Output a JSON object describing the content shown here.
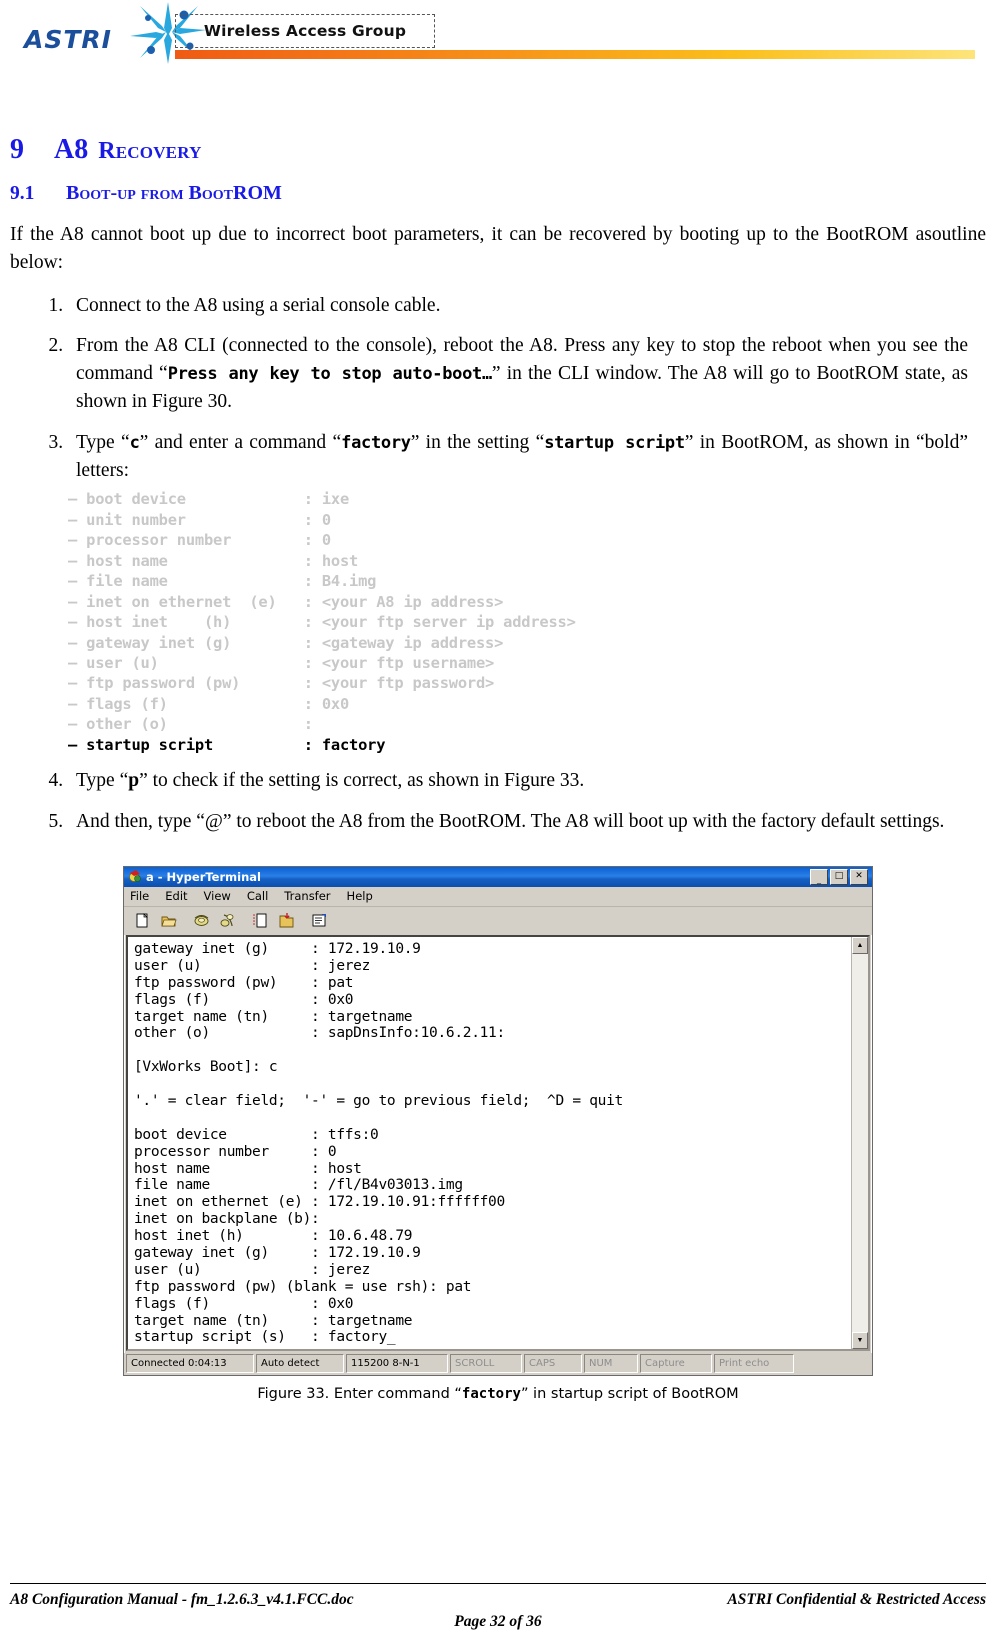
{
  "header": {
    "logo_text": "ASTRI",
    "logo_icon": "starburst-logo-icon",
    "group_label": "Wireless Access Group"
  },
  "section": {
    "h1_number": "9",
    "h1_title_lead": "A8",
    "h1_title_rest": "Recovery",
    "h2_number": "9.1",
    "h2_title": "Boot-up from BootROM",
    "intro": "If the A8 cannot boot up due to incorrect boot parameters, it can be recovered by booting up to the BootROM asoutline below:"
  },
  "steps": [
    {
      "parts": [
        {
          "t": "text",
          "v": "Connect to the A8 using a serial console cable."
        }
      ]
    },
    {
      "parts": [
        {
          "t": "text",
          "v": "From the A8 CLI (connected to the console), reboot the A8. Press any key to stop the reboot when you see the command “"
        },
        {
          "t": "mono",
          "v": "Press any key to stop auto-boot…"
        },
        {
          "t": "text",
          "v": "” in the CLI window. The A8 will go to BootROM state, as shown in Figure 30."
        }
      ]
    },
    {
      "parts": [
        {
          "t": "text",
          "v": "Type “"
        },
        {
          "t": "mono",
          "v": "c"
        },
        {
          "t": "text",
          "v": "” and enter a command “"
        },
        {
          "t": "mono",
          "v": "factory"
        },
        {
          "t": "text",
          "v": "” in the setting “"
        },
        {
          "t": "mono",
          "v": "startup script"
        },
        {
          "t": "text",
          "v": "” in BootROM, as shown in “bold” letters:"
        }
      ]
    },
    {
      "parts": [
        {
          "t": "text",
          "v": "Type “"
        },
        {
          "t": "bold",
          "v": "p"
        },
        {
          "t": "text",
          "v": "” to check if the setting is correct, as shown in Figure 33."
        }
      ]
    },
    {
      "parts": [
        {
          "t": "text",
          "v": "And then, type “@” to reboot the A8 from the BootROM. The A8 will boot up with the factory default settings."
        }
      ]
    }
  ],
  "code_block": [
    {
      "label": "boot device",
      "value": "ixe",
      "bold": false
    },
    {
      "label": "unit number",
      "value": "0",
      "bold": false
    },
    {
      "label": "processor number",
      "value": "0",
      "bold": false
    },
    {
      "label": "host name",
      "value": "host",
      "bold": false
    },
    {
      "label": "file name",
      "value": "B4.img",
      "bold": false
    },
    {
      "label": "inet on ethernet  (e)",
      "value": "<your A8 ip address>",
      "bold": false
    },
    {
      "label": "host inet    (h)",
      "value": "<your ftp server ip address>",
      "bold": false
    },
    {
      "label": "gateway inet (g)",
      "value": "<gateway ip address>",
      "bold": false
    },
    {
      "label": "user (u)",
      "value": "<your ftp username>",
      "bold": false
    },
    {
      "label": "ftp password (pw)",
      "value": "<your ftp password>",
      "bold": false
    },
    {
      "label": "flags (f)",
      "value": "0x0",
      "bold": false
    },
    {
      "label": "other (o)",
      "value": "",
      "bold": false
    },
    {
      "label": "startup script",
      "value": "factory",
      "bold": true
    }
  ],
  "hyperterminal": {
    "title": "a - HyperTerminal",
    "app_icon": "hyperterminal-icon",
    "window_buttons": [
      {
        "name": "minimize-button",
        "glyph": "_"
      },
      {
        "name": "maximize-button",
        "glyph": "□"
      },
      {
        "name": "close-button",
        "glyph": "×"
      }
    ],
    "menus": [
      "File",
      "Edit",
      "View",
      "Call",
      "Transfer",
      "Help"
    ],
    "toolbar": [
      {
        "name": "new-connection-icon"
      },
      {
        "name": "open-folder-icon"
      },
      {
        "name": "disconnect-phone-icon"
      },
      {
        "name": "call-phone-icon"
      },
      {
        "name": "send-file-icon"
      },
      {
        "name": "receive-file-icon"
      },
      {
        "name": "properties-icon"
      }
    ],
    "terminal_lines": [
      "gateway inet (g)     : 172.19.10.9",
      "user (u)             : jerez",
      "ftp password (pw)    : pat",
      "flags (f)            : 0x0",
      "target name (tn)     : targetname",
      "other (o)            : sapDnsInfo:10.6.2.11:",
      "",
      "[VxWorks Boot]: c",
      "",
      "'.' = clear field;  '-' = go to previous field;  ^D = quit",
      "",
      "boot device          : tffs:0",
      "processor number     : 0",
      "host name            : host",
      "file name            : /fl/B4v03013.img",
      "inet on ethernet (e) : 172.19.10.91:ffffff00",
      "inet on backplane (b):",
      "host inet (h)        : 10.6.48.79",
      "gateway inet (g)     : 172.19.10.9",
      "user (u)             : jerez",
      "ftp password (pw) (blank = use rsh): pat",
      "flags (f)            : 0x0",
      "target name (tn)     : targetname",
      "startup script (s)   : factory_"
    ],
    "status_bar": [
      {
        "name": "connection-status",
        "label": "Connected 0:04:13",
        "grayed": false
      },
      {
        "name": "detection-mode",
        "label": "Auto detect",
        "grayed": false
      },
      {
        "name": "line-settings",
        "label": "115200 8-N-1",
        "grayed": false
      },
      {
        "name": "scroll-indicator",
        "label": "SCROLL",
        "grayed": true
      },
      {
        "name": "caps-indicator",
        "label": "CAPS",
        "grayed": true
      },
      {
        "name": "num-indicator",
        "label": "NUM",
        "grayed": true
      },
      {
        "name": "capture-indicator",
        "label": "Capture",
        "grayed": true
      },
      {
        "name": "print-echo-indicator",
        "label": "Print echo",
        "grayed": true
      }
    ]
  },
  "figure_caption": {
    "pre": "Figure 33. Enter command “",
    "mono": "factory",
    "post": "” in startup script of BootROM"
  },
  "footer": {
    "left": "A8 Configuration Manual - fm_1.2.6.3_v4.1.FCC.doc",
    "right": "ASTRI Confidential & Restricted Access",
    "center": "Page 32 of 36"
  }
}
